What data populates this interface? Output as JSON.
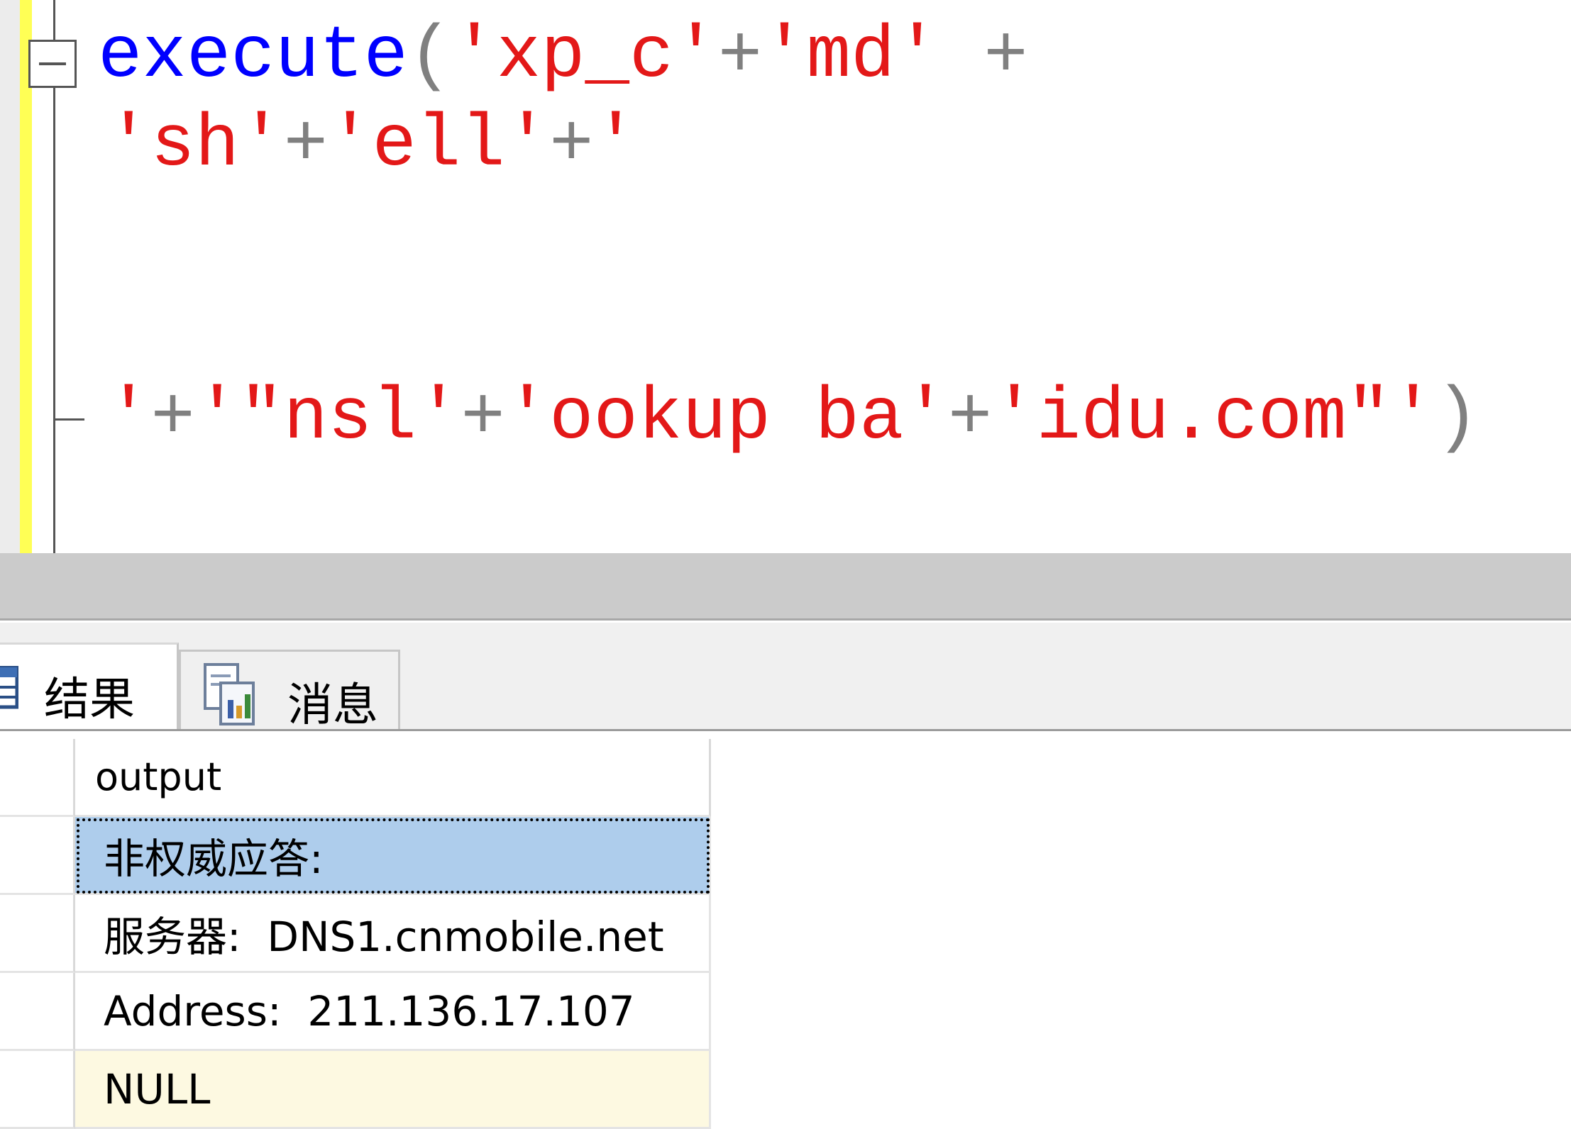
{
  "editor": {
    "line1": {
      "keyword": "execute",
      "paren_open": "(",
      "str1": "'xp_c'",
      "plus1": "+",
      "str2": "'md'",
      "plus2": " +"
    },
    "line2": {
      "str1": "'sh'",
      "plus1": "+",
      "str2": "'ell'",
      "plus2": "+",
      "str3": "'"
    },
    "line3": {
      "str1": "'",
      "plus1": "+",
      "str2": "'\"nsl'",
      "plus2": "+",
      "str3": "'ookup ba'",
      "plus3": "+",
      "str4": "'idu.com\"'",
      "paren_close": ")"
    }
  },
  "tabs": {
    "results": "结果",
    "messages": "消息"
  },
  "grid": {
    "column_header": "output",
    "rows": [
      "非权威应答:",
      "服务器:  DNS1.cnmobile.net",
      "Address:  211.136.17.107",
      "NULL"
    ]
  },
  "colors": {
    "keyword": "#0000ff",
    "string": "#e31818",
    "operator": "#808080",
    "selected_row": "#aecdec",
    "null_row": "#fdf9e1"
  }
}
